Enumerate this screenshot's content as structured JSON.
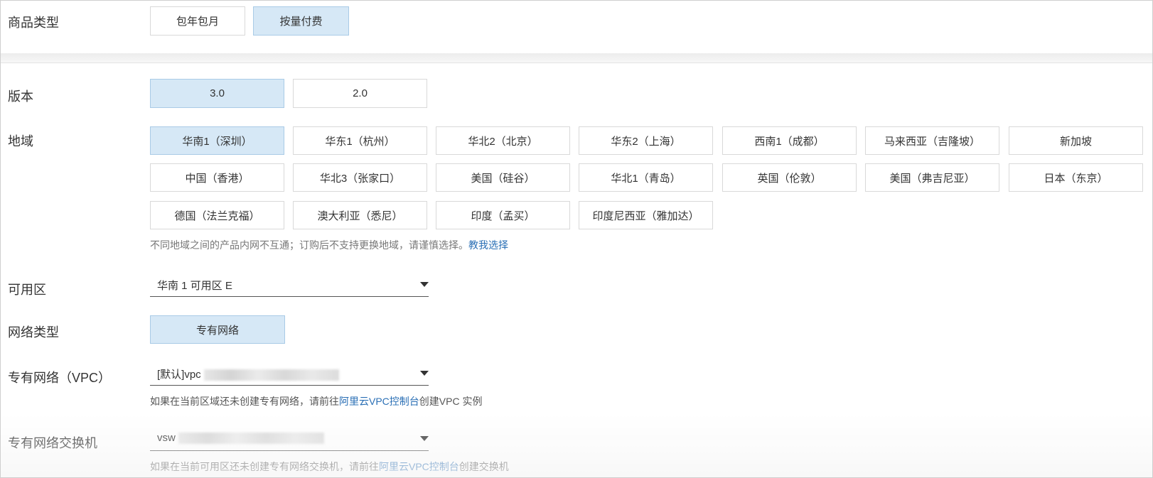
{
  "product_type": {
    "label": "商品类型",
    "options": [
      {
        "label": "包年包月",
        "selected": false
      },
      {
        "label": "按量付费",
        "selected": true
      }
    ]
  },
  "version": {
    "label": "版本",
    "options": [
      {
        "label": "3.0",
        "selected": true
      },
      {
        "label": "2.0",
        "selected": false
      }
    ]
  },
  "region": {
    "label": "地域",
    "options": [
      {
        "label": "华南1（深圳）",
        "selected": true
      },
      {
        "label": "华东1（杭州）",
        "selected": false
      },
      {
        "label": "华北2（北京）",
        "selected": false
      },
      {
        "label": "华东2（上海）",
        "selected": false
      },
      {
        "label": "西南1（成都）",
        "selected": false
      },
      {
        "label": "马来西亚（吉隆坡）",
        "selected": false
      },
      {
        "label": "新加坡",
        "selected": false
      },
      {
        "label": "中国（香港）",
        "selected": false
      },
      {
        "label": "华北3（张家口）",
        "selected": false
      },
      {
        "label": "美国（硅谷）",
        "selected": false
      },
      {
        "label": "华北1（青岛）",
        "selected": false
      },
      {
        "label": "英国（伦敦）",
        "selected": false
      },
      {
        "label": "美国（弗吉尼亚）",
        "selected": false
      },
      {
        "label": "日本（东京）",
        "selected": false
      },
      {
        "label": "德国（法兰克福）",
        "selected": false
      },
      {
        "label": "澳大利亚（悉尼）",
        "selected": false
      },
      {
        "label": "印度（孟买）",
        "selected": false
      },
      {
        "label": "印度尼西亚（雅加达）",
        "selected": false
      }
    ],
    "hint_text": "不同地域之间的产品内网不互通；订购后不支持更换地域，请谨慎选择。",
    "hint_link": "教我选择"
  },
  "zone": {
    "label": "可用区",
    "value": "华南 1 可用区 E"
  },
  "network_type": {
    "label": "网络类型",
    "options": [
      {
        "label": "专有网络",
        "selected": true
      }
    ]
  },
  "vpc": {
    "label": "专有网络（VPC）",
    "value": "[默认]vpc",
    "hint_prefix": "如果在当前区域还未创建专有网络，请前往",
    "hint_link": "阿里云VPC控制台",
    "hint_suffix": "创建VPC 实例"
  },
  "vswitch": {
    "label": "专有网络交换机",
    "value": "vsw",
    "hint_prefix": "如果在当前可用区还未创建专有网络交换机，请前往",
    "hint_link": "阿里云VPC控制台",
    "hint_suffix": "创建交换机"
  },
  "colors": {
    "selected_bg": "#d6e8f6",
    "selected_border": "#a9cbe6",
    "link": "#2a6fb5",
    "hint": "#777777"
  },
  "icons": {
    "select_caret": "caret-down-icon"
  }
}
